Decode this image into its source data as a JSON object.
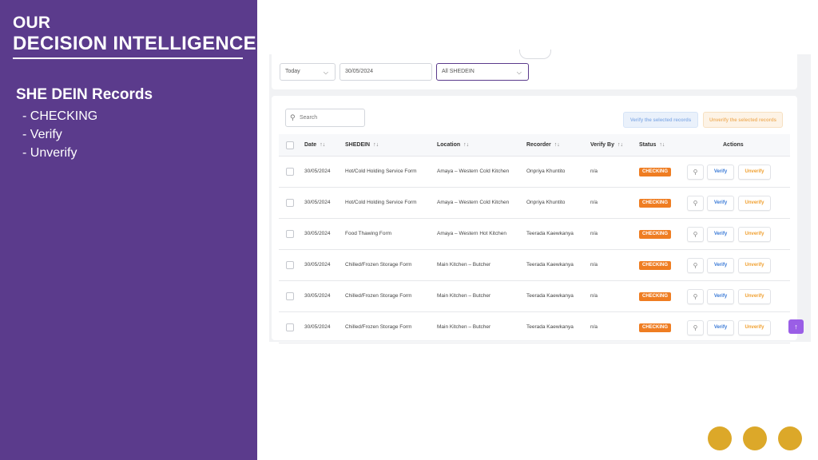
{
  "slide": {
    "brand_top": "OUR",
    "brand_main": "DECISION INTELLIGENCE",
    "section_title": "SHE DEIN Records",
    "bullets": [
      "- CHECKING",
      "- Verify",
      "- Unverify"
    ],
    "accent_color": "#5b3b8c",
    "dot_color": "#dca829"
  },
  "filters": {
    "period": "Today",
    "date": "30/05/2024",
    "shedein": "All SHEDEIN"
  },
  "toolbar": {
    "search_placeholder": "Search",
    "verify_selected": "Verify the selected records",
    "unverify_selected": "Unverify the selected records"
  },
  "table": {
    "columns": {
      "date": "Date",
      "shedein": "SHEDEIN",
      "location": "Location",
      "recorder": "Recorder",
      "verify_by": "Verify By",
      "status": "Status",
      "actions": "Actions"
    },
    "sort_icon": "↑↓",
    "rows": [
      {
        "date": "30/05/2024",
        "shedein": "Hot/Cold Holding Service Form",
        "location": "Amaya – Western Cold Kitchen",
        "recorder": "Onpriya Khuntito",
        "verify_by": "n/a",
        "status": "CHECKING",
        "verify": "Verify",
        "unverify": "Unverify"
      },
      {
        "date": "30/05/2024",
        "shedein": "Hot/Cold Holding Service Form",
        "location": "Amaya – Western Cold Kitchen",
        "recorder": "Onpriya Khuntito",
        "verify_by": "n/a",
        "status": "CHECKING",
        "verify": "Verify",
        "unverify": "Unverify"
      },
      {
        "date": "30/05/2024",
        "shedein": "Food Thawing Form",
        "location": "Amaya – Western Hot Kitchen",
        "recorder": "Teerada Kaewkanya",
        "verify_by": "n/a",
        "status": "CHECKING",
        "verify": "Verify",
        "unverify": "Unverify"
      },
      {
        "date": "30/05/2024",
        "shedein": "Chilled/Frozen Storage Form",
        "location": "Main Kitchen – Butcher",
        "recorder": "Teerada Kaewkanya",
        "verify_by": "n/a",
        "status": "CHECKING",
        "verify": "Verify",
        "unverify": "Unverify"
      },
      {
        "date": "30/05/2024",
        "shedein": "Chilled/Frozen Storage Form",
        "location": "Main Kitchen – Butcher",
        "recorder": "Teerada Kaewkanya",
        "verify_by": "n/a",
        "status": "CHECKING",
        "verify": "Verify",
        "unverify": "Unverify"
      },
      {
        "date": "30/05/2024",
        "shedein": "Chilled/Frozen Storage Form",
        "location": "Main Kitchen – Butcher",
        "recorder": "Teerada Kaewkanya",
        "verify_by": "n/a",
        "status": "CHECKING",
        "verify": "Verify",
        "unverify": "Unverify"
      }
    ]
  },
  "icons": {
    "search": "search-icon",
    "chevron": "chevron-down-icon",
    "arrow_up": "arrow-up-icon"
  },
  "status_colors": {
    "checking": "#ef7d22",
    "verify": "#3a7ad6",
    "unverify": "#f0a030"
  }
}
